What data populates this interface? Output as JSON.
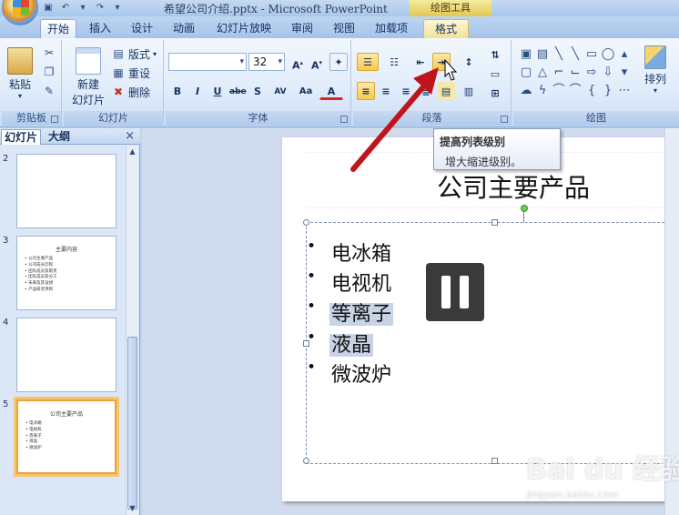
{
  "window": {
    "title": "希望公司介绍.pptx - Microsoft PowerPoint",
    "context_tab_group": "绘图工具"
  },
  "quick_access": [
    {
      "icon": "save-icon"
    },
    {
      "icon": "undo-icon"
    },
    {
      "icon": "redo-icon"
    }
  ],
  "tabs": [
    "开始",
    "插入",
    "设计",
    "动画",
    "幻灯片放映",
    "审阅",
    "视图",
    "加载项",
    "格式"
  ],
  "active_tab": "开始",
  "ribbon": {
    "clipboard": {
      "paste": "粘贴",
      "label": "剪贴板"
    },
    "slides": {
      "new_slide_line1": "新建",
      "new_slide_line2": "幻灯片",
      "layout": "版式",
      "reset": "重设",
      "delete": "删除",
      "label": "幻灯片"
    },
    "font": {
      "font_name": "",
      "font_size": "32",
      "label": "字体",
      "buttons": [
        "B",
        "I",
        "U",
        "abe",
        "S",
        "AV",
        "Aa",
        "A"
      ]
    },
    "paragraph": {
      "label": "段落",
      "highlighted_button": "increase-indent"
    },
    "drawing": {
      "label": "绘图",
      "arrange": "排列"
    }
  },
  "tooltip": {
    "title": "提高列表级别",
    "description": "增大缩进级别。"
  },
  "pane": {
    "tabs": [
      "幻灯片",
      "大纲"
    ],
    "close": "×",
    "slides": [
      {
        "num": "2",
        "title": "",
        "items": []
      },
      {
        "num": "3",
        "title": "主要内容",
        "items": [
          "公司主要产品",
          "公司成长历程",
          "团队成员及职责",
          "团队成员及分工",
          "未来及其设想",
          "产品研究项目"
        ]
      },
      {
        "num": "4",
        "title": "",
        "items": []
      },
      {
        "num": "5",
        "title": "公司主要产品",
        "items": [
          "电冰箱",
          "电视机",
          "等离子",
          "液晶",
          "微波炉"
        ],
        "selected": true
      }
    ]
  },
  "slide": {
    "title": "公司主要产品",
    "bullets": [
      {
        "text": "电冰箱",
        "selected": false
      },
      {
        "text": "电视机",
        "selected": false
      },
      {
        "text": "等离子",
        "selected": true
      },
      {
        "text": "液晶",
        "selected": true
      },
      {
        "text": "微波炉",
        "selected": false
      }
    ]
  },
  "watermark": {
    "text": "Bai du 经验",
    "url": "jingyan.baidu.com"
  }
}
